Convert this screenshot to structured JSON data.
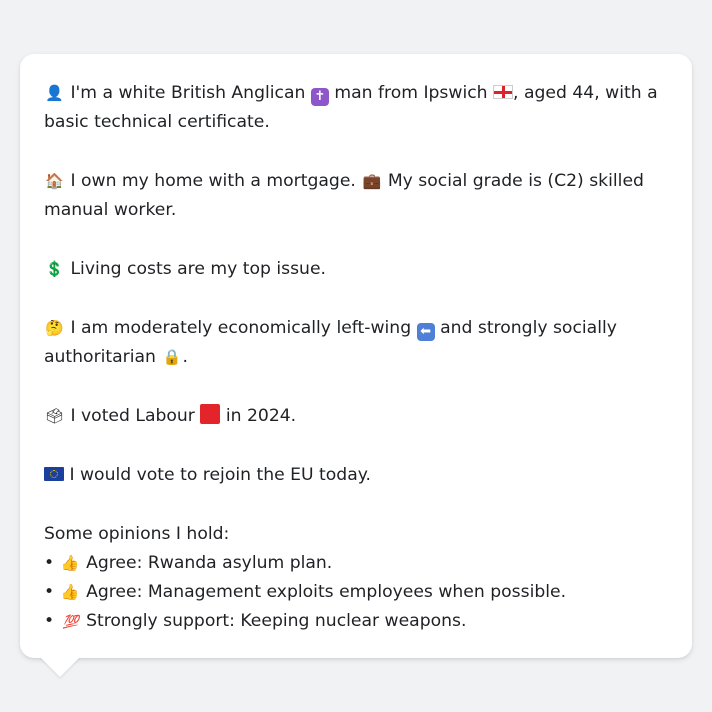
{
  "profile": {
    "line1_a": "I'm a white British Anglican",
    "line1_b": "man from Ipswich",
    "line1_c": ", aged 44, with a basic technical certificate.",
    "line2_a": "I own my home with a mortgage.",
    "line2_b": "My social grade is (C2) skilled manual worker.",
    "line3": "Living costs are my top issue.",
    "line4_a": "I am moderately economically left-wing",
    "line4_b": "and strongly socially authoritarian",
    "line4_c": ".",
    "line5_a": "I voted Labour",
    "line5_b": "in 2024.",
    "line6": "I would vote to rejoin the EU today."
  },
  "opinions": {
    "heading": "Some opinions I hold:",
    "items": [
      {
        "bullet": "•",
        "text": "Agree: Rwanda asylum plan.",
        "icon": "thumbs-up-icon"
      },
      {
        "bullet": "•",
        "text": "Agree: Management exploits employees when possible.",
        "icon": "thumbs-up-icon"
      },
      {
        "bullet": "•",
        "text": "Strongly support: Keeping nuclear weapons.",
        "icon": "hundred-points-icon"
      }
    ]
  },
  "colors": {
    "background": "#f1f2f4",
    "bubble": "#ffffff",
    "text": "#1f2125"
  }
}
